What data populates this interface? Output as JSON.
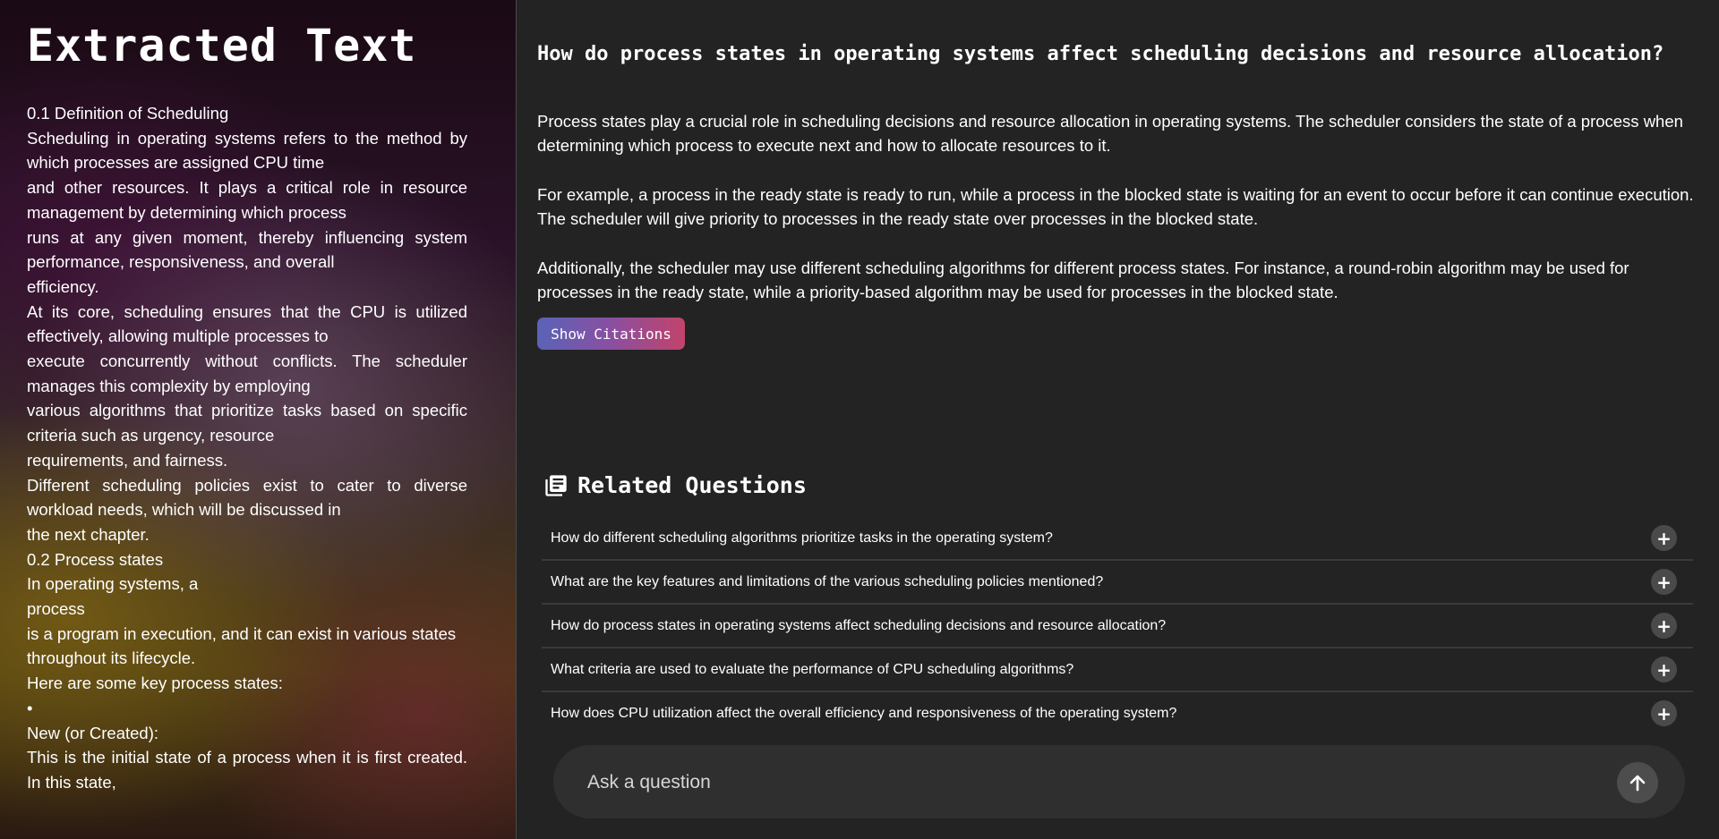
{
  "extracted_panel": {
    "title": "Extracted Text",
    "lines": [
      "0.1 Definition of Scheduling",
      "Scheduling in operating systems refers to the method by which processes are assigned CPU time",
      "and other resources. It plays a critical role in resource management by determining which process",
      "runs at any given moment, thereby influencing system performance, responsiveness, and overall",
      "efficiency.",
      "At its core, scheduling ensures that the CPU is utilized effectively, allowing multiple processes to",
      "execute concurrently without conflicts. The scheduler manages this complexity by employing",
      "various algorithms that prioritize tasks based on specific criteria such as urgency, resource",
      "requirements, and fairness.",
      "Different scheduling policies exist to cater to diverse workload needs, which will be discussed in",
      "the next chapter.",
      "0.2 Process states",
      "In operating systems, a",
      "process",
      "is a program in execution, and it can exist in various states",
      "throughout its lifecycle.",
      "Here are some key process states:",
      "•",
      "New (or Created):",
      "This is the initial state of a process when it is first created. In this state,"
    ]
  },
  "qa": {
    "question": "How do process states in operating systems affect scheduling decisions and resource allocation?",
    "answer_paragraphs": [
      "Process states play a crucial role in scheduling decisions and resource allocation in operating systems. The scheduler considers the state of a process when determining which process to execute next and how to allocate resources to it.",
      "For example, a process in the ready state is ready to run, while a process in the blocked state is waiting for an event to occur before it can continue execution. The scheduler will give priority to processes in the ready state over processes in the blocked state.",
      "Additionally, the scheduler may use different scheduling algorithms for different process states. For instance, a round-robin algorithm may be used for processes in the ready state, while a priority-based algorithm may be used for processes in the blocked state."
    ],
    "citations_label": "Show Citations"
  },
  "related": {
    "title": "Related Questions",
    "icon": "library-books-icon",
    "items": [
      "How do different scheduling algorithms prioritize tasks in the operating system?",
      "What are the key features and limitations of the various scheduling policies mentioned?",
      "How do process states in operating systems affect scheduling decisions and resource allocation?",
      "What criteria are used to evaluate the performance of CPU scheduling algorithms?",
      "How does CPU utilization affect the overall efficiency and responsiveness of the operating system?"
    ],
    "expand_glyph": "+"
  },
  "ask": {
    "placeholder": "Ask a question",
    "send_icon": "arrow-up-icon"
  },
  "colors": {
    "background": "#232323",
    "citations_gradient": [
      "#5a63b8",
      "#8a4fa0",
      "#c2436a"
    ],
    "input_bg": "#2f2f2f"
  }
}
